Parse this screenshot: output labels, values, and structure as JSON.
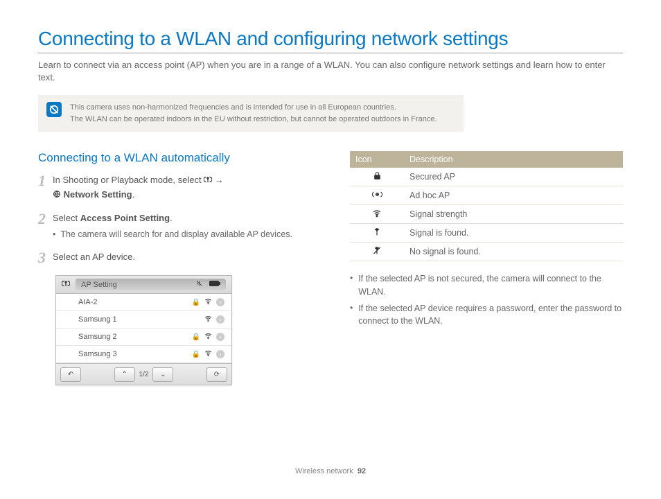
{
  "title": "Connecting to a WLAN and configuring network settings",
  "intro": "Learn to connect via an access point (AP) when you are in a range of a WLAN. You can also configure network settings and learn how to enter text.",
  "note": {
    "line1": "This camera uses non-harmonized frequencies and is intended for use in all European countries.",
    "line2": "The WLAN can be operated indoors in the EU without restriction, but cannot be operated outdoors in France."
  },
  "section_heading": "Connecting to a WLAN automatically",
  "steps": {
    "s1a": "In Shooting or Playback mode, select ",
    "s1b": " → ",
    "s1c": "Network Setting",
    "s1d": ".",
    "s2a": "Select ",
    "s2b": "Access Point Setting",
    "s2c": ".",
    "s2sub": "The camera will search for and display available AP devices.",
    "s3": "Select an AP device."
  },
  "apbox": {
    "title": "AP Setting",
    "items": [
      "AIA-2",
      "Samsung 1",
      "Samsung 2",
      "Samsung 3"
    ],
    "page": "1/2"
  },
  "icon_table": {
    "head_icon": "Icon",
    "head_desc": "Description",
    "rows": [
      {
        "name": "lock-icon",
        "desc": "Secured AP"
      },
      {
        "name": "adhoc-icon",
        "desc": "Ad hoc AP"
      },
      {
        "name": "wifi-icon",
        "desc": "Signal strength"
      },
      {
        "name": "antenna-icon",
        "desc": "Signal is found."
      },
      {
        "name": "no-signal-icon",
        "desc": "No signal is found."
      }
    ]
  },
  "bullets": [
    "If the selected AP is not secured, the camera will connect to the WLAN.",
    "If the selected AP device requires a password, enter the password to connect to the WLAN."
  ],
  "footer": {
    "section": "Wireless network",
    "page": "92"
  }
}
